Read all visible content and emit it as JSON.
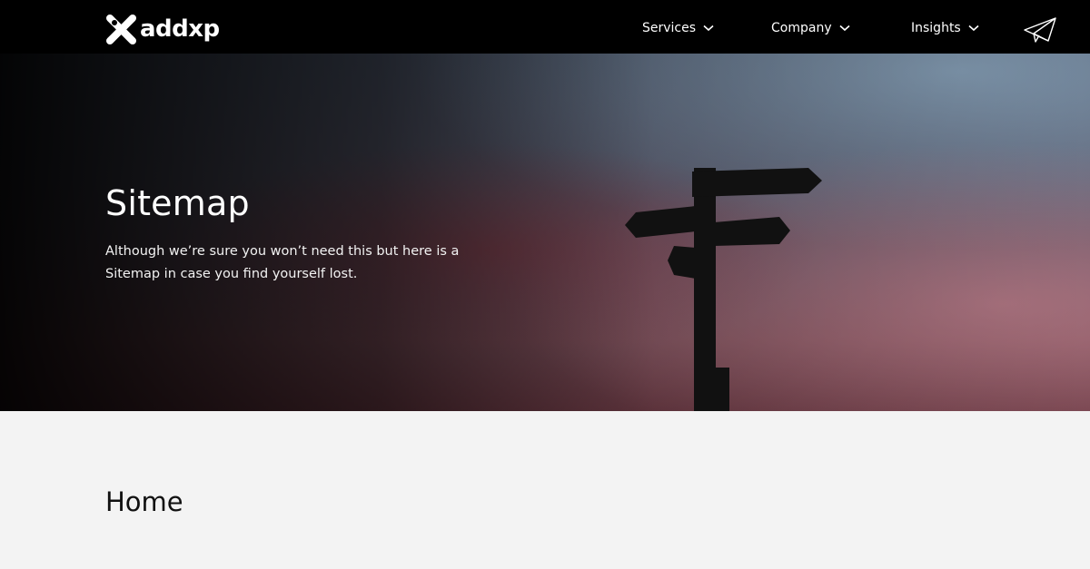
{
  "brand": {
    "name": "addxp"
  },
  "nav": {
    "items": [
      {
        "label": "Services"
      },
      {
        "label": "Company"
      },
      {
        "label": "Insights"
      }
    ]
  },
  "hero": {
    "title": "Sitemap",
    "description": "Although we’re sure you won’t need this but here is a Sitemap in case you find yourself lost."
  },
  "sections": [
    {
      "title": "Home"
    }
  ],
  "icons": {
    "logo": "addxp-x-logo-icon",
    "chevron": "chevron-down-icon",
    "send": "paper-plane-icon"
  },
  "colors": {
    "navbar": "#000000",
    "page_bg": "#f3f3f3",
    "text_dark": "#111111",
    "text_light": "#ffffff"
  }
}
